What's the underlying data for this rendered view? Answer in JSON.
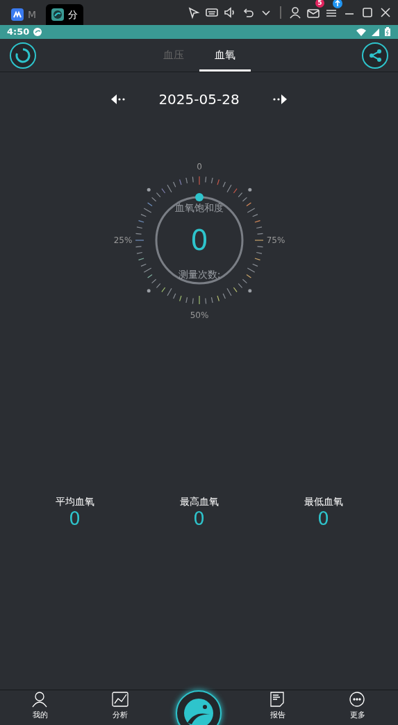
{
  "emulator_bar": {
    "tabs": [
      {
        "label": "M",
        "selected": false
      },
      {
        "label": "分",
        "selected": true
      }
    ],
    "mail_badge": "5"
  },
  "status_bar": {
    "time": "4:50"
  },
  "tabs": [
    {
      "label": "血压",
      "selected": false
    },
    {
      "label": "血氧",
      "selected": true
    }
  ],
  "date": "2025-05-28",
  "gauge": {
    "top_label": "0",
    "left_label": "25%",
    "bottom_label": "50%",
    "right_label": "75%",
    "title": "血氧饱和度",
    "value": "0",
    "subtitle": "测量次数:"
  },
  "stats": [
    {
      "label": "平均血氧",
      "value": "0"
    },
    {
      "label": "最高血氧",
      "value": "0"
    },
    {
      "label": "最低血氧",
      "value": "0"
    }
  ],
  "bottom_nav": [
    {
      "kind": "person",
      "label": "我的"
    },
    {
      "kind": "chart",
      "label": "分析"
    },
    {
      "kind": "logo"
    },
    {
      "kind": "report",
      "label": "报告"
    },
    {
      "kind": "more",
      "label": "更多"
    }
  ]
}
